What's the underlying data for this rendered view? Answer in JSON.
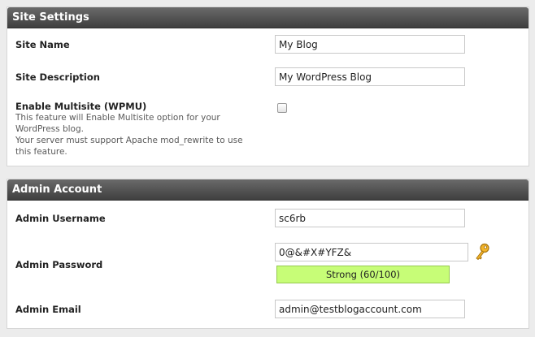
{
  "site_settings": {
    "title": "Site Settings",
    "site_name": {
      "label": "Site Name",
      "value": "My Blog"
    },
    "site_description": {
      "label": "Site Description",
      "value": "My WordPress Blog"
    },
    "multisite": {
      "label": "Enable Multisite (WPMU)",
      "help_line1": "This feature will Enable Multisite option for your WordPress blog.",
      "help_line2": "Your server must support Apache mod_rewrite to use this feature.",
      "checked": false
    }
  },
  "admin_account": {
    "title": "Admin Account",
    "username": {
      "label": "Admin Username",
      "value": "sc6rb"
    },
    "password": {
      "label": "Admin Password",
      "value": "0@&#X#YFZ&",
      "strength_text": "Strong (60/100)",
      "strength_color": "#c7fd77"
    },
    "email": {
      "label": "Admin Email",
      "value": "admin@testblogaccount.com"
    }
  },
  "icons": {
    "key": "key-icon"
  }
}
